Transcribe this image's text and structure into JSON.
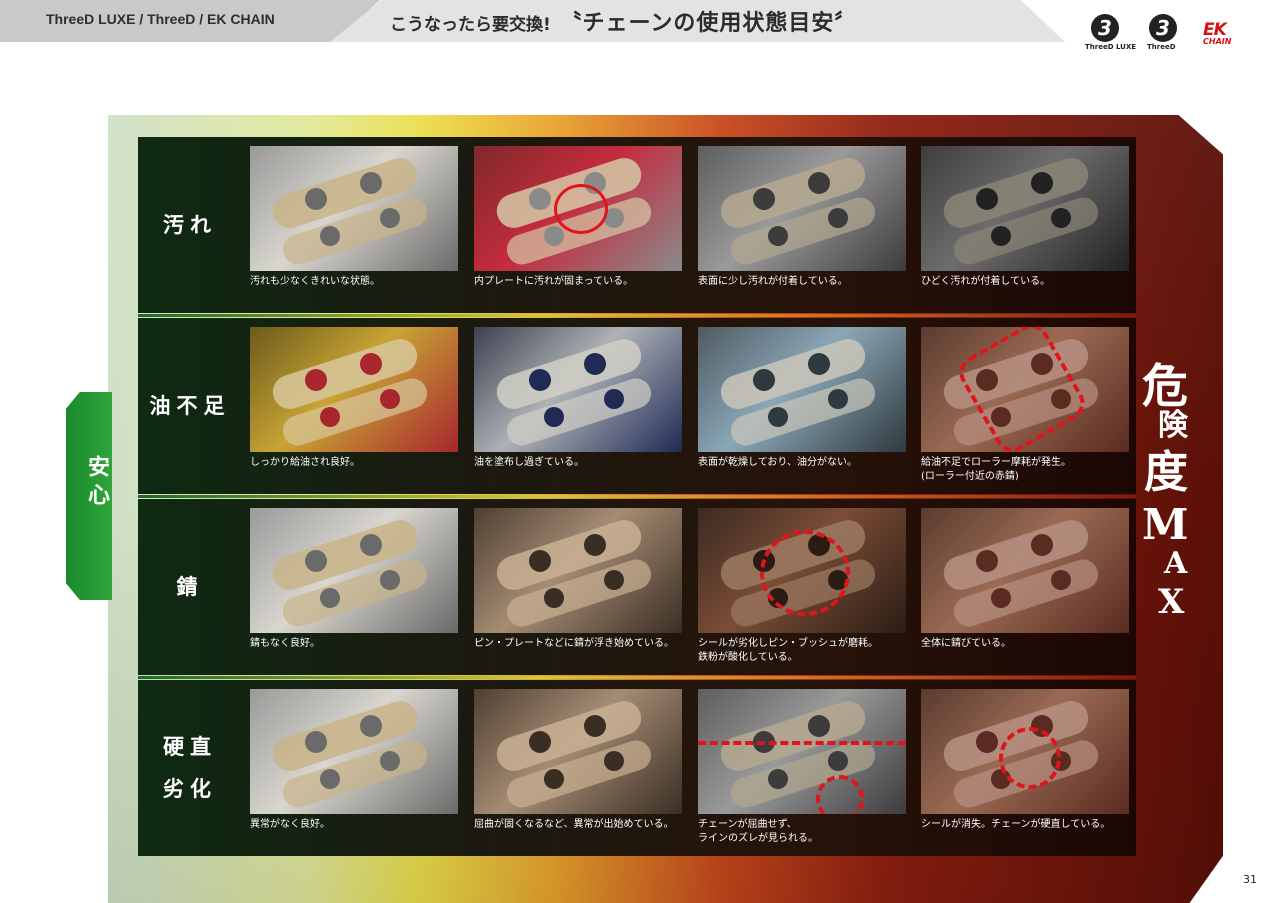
{
  "header": {
    "brand_line": "ThreeD LUXE / ThreeD / EK CHAIN",
    "title_prefix": "こうなったら要交換!",
    "title_main": "〝チェーンの使用状態目安〞"
  },
  "logos": [
    {
      "name": "ThreeD LUXE",
      "mark": "3"
    },
    {
      "name": "ThreeD",
      "mark": "3"
    },
    {
      "name": "EK",
      "sub": "CHAIN"
    }
  ],
  "left_tab": "安心",
  "right_label": {
    "chars": [
      "危",
      "険",
      "度",
      "M",
      "A",
      "X"
    ]
  },
  "rows": [
    {
      "label": "汚れ",
      "cells": [
        {
          "caption": "汚れも少なくきれいな状態。",
          "tone": "clean",
          "mark": "none"
        },
        {
          "caption": "内プレートに汚れが固まっている。",
          "tone": "red",
          "mark": "solid"
        },
        {
          "caption": "表面に少し汚れが付着している。",
          "tone": "grey",
          "mark": "none"
        },
        {
          "caption": "ひどく汚れが付着している。",
          "tone": "dark",
          "mark": "none"
        }
      ]
    },
    {
      "label": "油不足",
      "cells": [
        {
          "caption": "しっかり給油され良好。",
          "tone": "gold",
          "mark": "none"
        },
        {
          "caption": "油を塗布し過ぎている。",
          "tone": "silver",
          "mark": "none"
        },
        {
          "caption": "表面が乾燥しており、油分がない。",
          "tone": "blue",
          "mark": "none"
        },
        {
          "caption": "給油不足でローラー摩耗が発生。\n(ローラー付近の赤錆)",
          "tone": "rust",
          "mark": "dash-rect"
        }
      ]
    },
    {
      "label": "錆",
      "cells": [
        {
          "caption": "錆もなく良好。",
          "tone": "clean",
          "mark": "none"
        },
        {
          "caption": "ピン・プレートなどに錆が浮き始めている。",
          "tone": "brown",
          "mark": "none"
        },
        {
          "caption": "シールが劣化しピン・ブッシュが磨耗。\n鉄粉が酸化している。",
          "tone": "rusty",
          "mark": "dash-circle"
        },
        {
          "caption": "全体に錆びている。",
          "tone": "rust",
          "mark": "none"
        }
      ]
    },
    {
      "label": "硬直\n劣化",
      "cells": [
        {
          "caption": "異常がなく良好。",
          "tone": "clean",
          "mark": "none"
        },
        {
          "caption": "屈曲が固くなるなど、異常が出始めている。",
          "tone": "brown",
          "mark": "none"
        },
        {
          "caption": "チェーンが屈曲せず、\nラインのズレが見られる。",
          "tone": "grey",
          "mark": "dash-line"
        },
        {
          "caption": "シールが消失。チェーンが硬直している。",
          "tone": "rust",
          "mark": "dash-small"
        }
      ]
    }
  ],
  "page_number": "31",
  "colors": {
    "panel_safe": "#cfe0c9",
    "panel_danger": "#5a0f07",
    "tab_green": "#1a8a2a",
    "mark_red": "#e0141a"
  }
}
